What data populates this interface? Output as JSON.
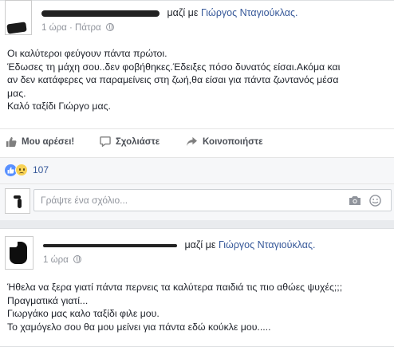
{
  "post1": {
    "author_suffix": "μαζί με",
    "tagged_friend": "Γιώργος Νταγιούκλας.",
    "time": "1 ώρα",
    "separator": "·",
    "location": "Πάτρα",
    "body_lines": [
      "Οι καλύτεροι φεύγουν πάντα πρώτοι.",
      "Έδωσες τη μάχη σου..δεν φοβήθηκες.Έδειξες πόσο δυνατός είσαι.Ακόμα και",
      "αν δεν κατάφερες να παραμείνεις στη ζωή,θα είσαι για πάντα ζωντανός μέσα",
      "μας.",
      "Καλό ταξίδι Γιώργο μας."
    ],
    "actions": {
      "like": "Μου αρέσει!",
      "comment": "Σχολιάστε",
      "share": "Κοινοποιήστε"
    },
    "reaction_count": "107",
    "comment_placeholder": "Γράψτε ένα σχόλιο...",
    "colors": {
      "link": "#365899",
      "like_blue": "#5890ff",
      "sad_yellow": "#f7d154"
    }
  },
  "post2": {
    "author_suffix": "μαζί με",
    "tagged_friend": "Γιώργος Νταγιούκλας.",
    "time": "1 ώρα",
    "body_lines": [
      "Ήθελα να ξερα γιατί πάντα περνεις τα καλύτερα παιδιά τις πιο αθώες ψυχές;;;",
      "Πραγματικά γιατί...",
      "Γιωργάκο μας καλο ταξίδι φιλε μου.",
      "Το χαμόγελο σου θα μου μείνει για πάντα εδώ κούκλε μου....."
    ]
  }
}
